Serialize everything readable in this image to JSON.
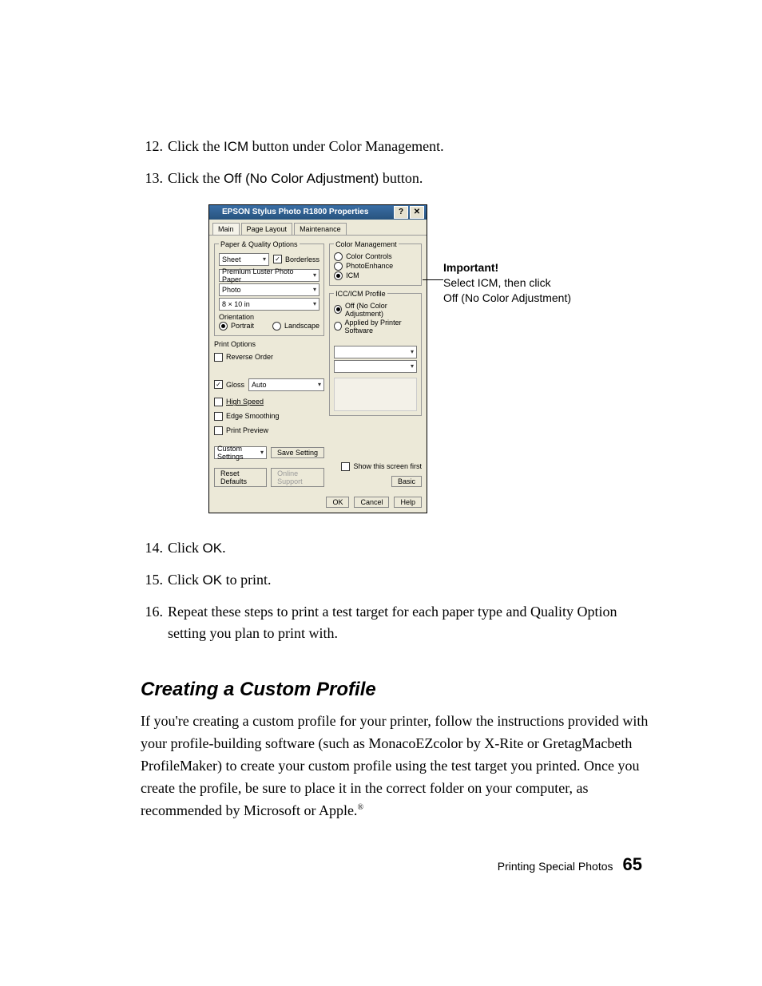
{
  "steps": {
    "s12a": "Click the ",
    "s12b": "ICM",
    "s12c": " button under Color Management.",
    "s13a": "Click the ",
    "s13b": "Off (No Color Adjustment)",
    "s13c": " button.",
    "s14a": "Click ",
    "s14b": "OK",
    "s14c": ".",
    "s15a": "Click ",
    "s15b": "OK",
    "s15c": " to print.",
    "s16": "Repeat these steps to print a test target for each paper type and Quality Option setting you plan to print with."
  },
  "nums": {
    "n12": "12.",
    "n13": "13.",
    "n14": "14.",
    "n15": "15.",
    "n16": "16."
  },
  "dialog": {
    "title": "EPSON Stylus Photo R1800 Properties",
    "help": "?",
    "close": "✕",
    "tabs": {
      "main": "Main",
      "layout": "Page Layout",
      "maint": "Maintenance"
    },
    "left": {
      "legend": "Paper & Quality Options",
      "sheet": "Sheet",
      "borderless": "Borderless",
      "paper": "Premium Luster Photo Paper",
      "quality": "Photo",
      "size": "8 × 10 in",
      "orient_legend": "Orientation",
      "portrait": "Portrait",
      "landscape": "Landscape",
      "print_opts": "Print Options",
      "reverse": "Reverse Order",
      "gloss": "Gloss",
      "gloss_mode": "Auto",
      "high_speed": "High Speed",
      "edge": "Edge Smoothing",
      "preview": "Print Preview",
      "custom": "Custom Settings",
      "save": "Save Setting",
      "reset": "Reset Defaults",
      "support": "Online Support"
    },
    "right": {
      "cm_legend": "Color Management",
      "cc": "Color Controls",
      "pe": "PhotoEnhance",
      "icm": "ICM",
      "icc_legend": "ICC/ICM Profile",
      "off": "Off (No Color Adjustment)",
      "applied": "Applied by Printer Software",
      "show": "Show this screen first",
      "basic": "Basic"
    },
    "bottom": {
      "ok": "OK",
      "cancel": "Cancel",
      "help": "Help"
    }
  },
  "callout": {
    "lead": "Important!",
    "l1": "Select ICM, then click",
    "l2": "Off (No Color Adjustment)"
  },
  "section_title": "Creating a Custom Profile",
  "section_body": "If you're creating a custom profile for your printer, follow the instructions provided with your profile-building software (such as MonacoEZcolor by X-Rite or GretagMacbeth ProfileMaker) to create your custom profile using the test target you printed. Once you create the profile, be sure to place it in the correct folder on your computer, as recommended by Microsoft or Apple.",
  "reg": "®",
  "footer": {
    "section": "Printing Special Photos",
    "page": "65"
  }
}
